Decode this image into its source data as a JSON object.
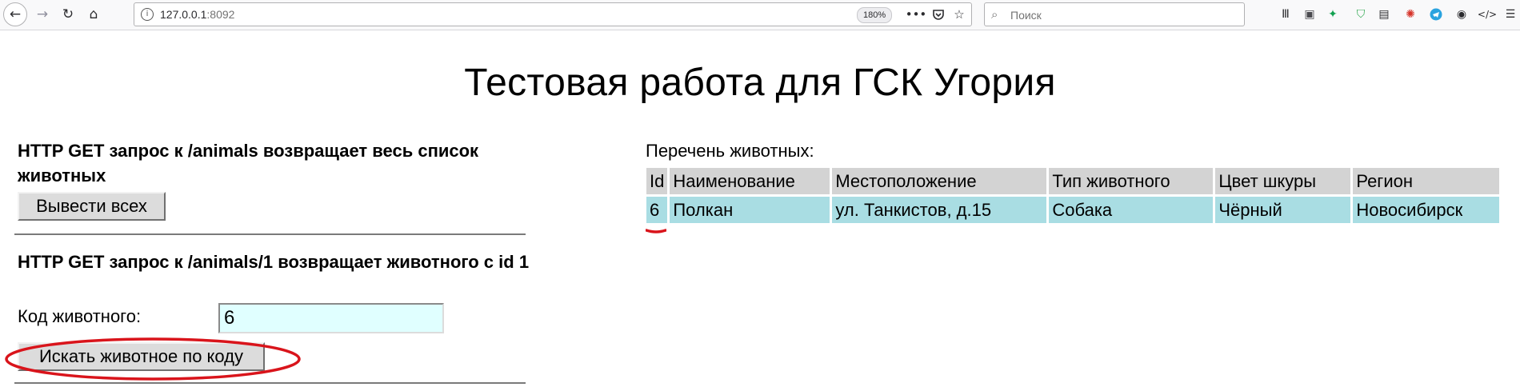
{
  "browser": {
    "url_host": "127.0.0.1",
    "url_port": ":8092",
    "zoom": "180%",
    "search_placeholder": "Поиск",
    "icons": {
      "back": "back-arrow-icon",
      "forward": "forward-arrow-icon",
      "reload": "reload-icon",
      "home": "home-icon",
      "site_info": "info-icon",
      "page_actions": "more-icon",
      "pocket": "pocket-icon",
      "bookmark": "star-icon",
      "search": "search-icon",
      "extensions": [
        "library-icon",
        "screenshot-icon",
        "extension-green-icon",
        "shield-icon",
        "reader-icon",
        "extension-colorful-icon",
        "telegram-icon",
        "account-icon",
        "devtools-icon",
        "menu-icon"
      ]
    }
  },
  "page": {
    "title": "Тестовая работа для ГСК Угория",
    "sections": [
      {
        "heading": "HTTP GET запрос к /animals возвращает весь список животных",
        "button_label": "Вывести всех"
      },
      {
        "heading": "HTTP GET запрос к /animals/1 возвращает животного с id 1",
        "field_label": "Код животного:",
        "field_value": "6",
        "button_label": "Искать животное по коду"
      }
    ],
    "list": {
      "caption": "Перечень животных:",
      "columns": [
        "Id",
        "Наименование",
        "Местоположение",
        "Тип животного",
        "Цвет шкуры",
        "Регион"
      ],
      "rows": [
        [
          "6",
          "Полкан",
          "ул. Танкистов, д.15",
          "Собака",
          "Чёрный",
          "Новосибирск"
        ]
      ]
    }
  },
  "annotations": {
    "color": "#d9141b",
    "marked": [
      "search-by-code-button",
      "cell-id"
    ]
  }
}
